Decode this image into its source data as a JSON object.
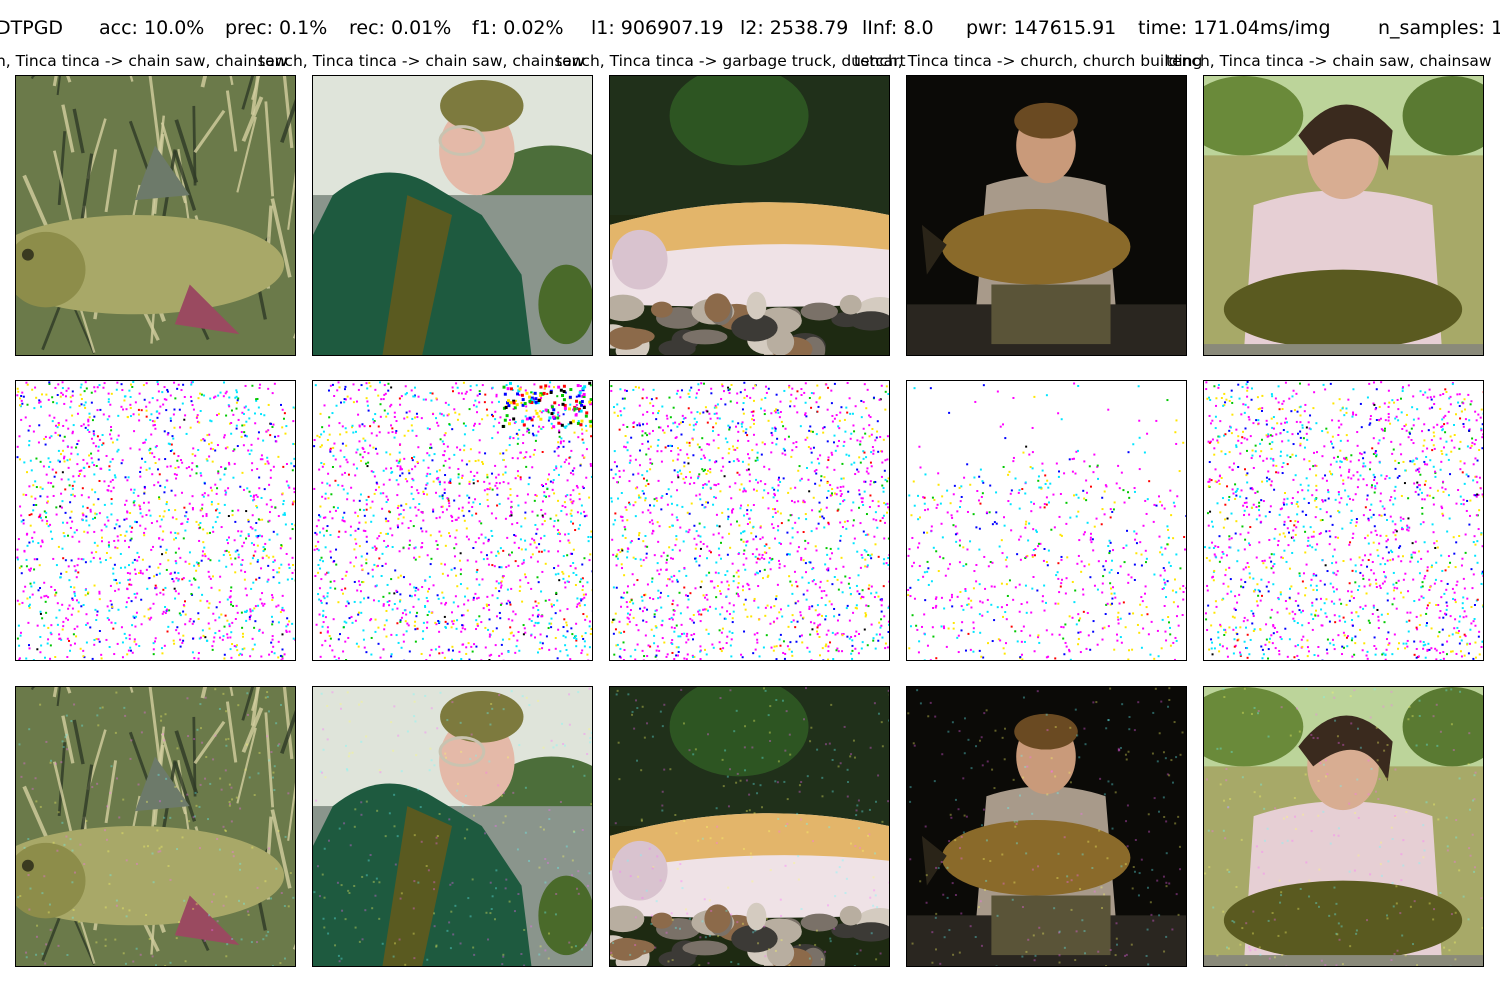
{
  "stats": {
    "method": "DTPGD",
    "acc": "acc: 10.0%",
    "prec": "prec: 0.1%",
    "rec": "rec: 0.01%",
    "f1": "f1: 0.02%",
    "l1": "l1: 906907.19",
    "l2": "l2: 2538.79",
    "linf": "lInf: 8.0",
    "pwr": "pwr: 147615.91",
    "time": "time: 171.04ms/img",
    "n_samples": "n_samples: 1"
  },
  "captions": [
    "tench, Tinca tinca -> chain saw, chainsaw",
    "tench, Tinca tinca -> chain saw, chainsaw",
    "tench, Tinca tinca -> garbage truck, dustcart",
    "tench, Tinca tinca -> church, church building",
    "tench, Tinca tinca -> chain saw, chainsaw"
  ],
  "rows": [
    {
      "role": "original"
    },
    {
      "role": "perturbation"
    },
    {
      "role": "adversarial"
    }
  ],
  "images": [
    {
      "scene": "tench lying on reeds",
      "palette": {
        "bg": "#6b7a4a",
        "accent": "#a8a868",
        "dark": "#2f3a26",
        "light": "#d4cfa0"
      }
    },
    {
      "scene": "elderly man in green jacket by a lake",
      "palette": {
        "bg": "#9aab8c",
        "accent": "#1e5a3f",
        "dark": "#1c2a20",
        "light": "#d9d7c8"
      }
    },
    {
      "scene": "pale fish over pebbles",
      "palette": {
        "bg": "#1e2a12",
        "accent": "#e3b56a",
        "dark": "#0c0c08",
        "light": "#efe2e6"
      }
    },
    {
      "scene": "boy holding a bream at night",
      "palette": {
        "bg": "#0e0c08",
        "accent": "#8a6a2a",
        "dark": "#000000",
        "light": "#a89a8a"
      }
    },
    {
      "scene": "teen holding a carp by a lake",
      "palette": {
        "bg": "#a7a968",
        "accent": "#5a5a20",
        "dark": "#3a2a1e",
        "light": "#e6cfd4"
      }
    }
  ]
}
